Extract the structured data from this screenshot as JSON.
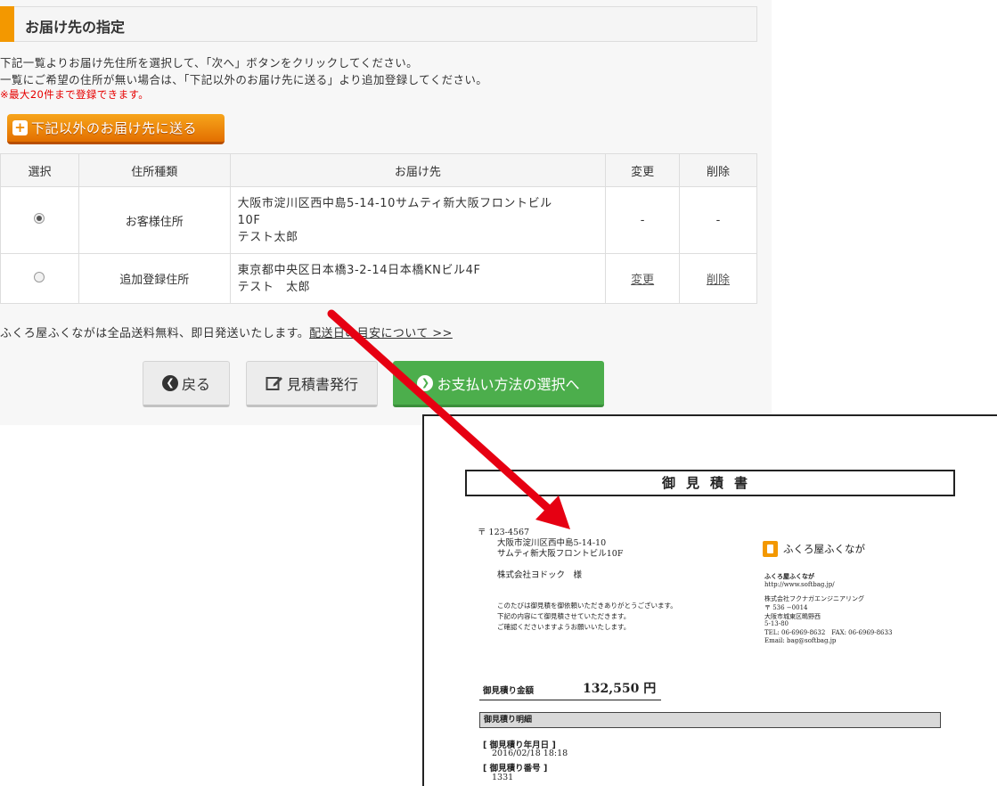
{
  "page": {
    "section_title": "お届け先の指定",
    "instruction_1": "下記一覧よりお届け先住所を選択して、「次へ」ボタンをクリックしてください。",
    "instruction_2": "一覧にご希望の住所が無い場合は、「下記以外のお届け先に送る」より追加登録してください。",
    "note": "※最大20件まで登録できます。",
    "add_button": "下記以外のお届け先に送る",
    "table": {
      "headers": [
        "選択",
        "住所種類",
        "お届け先",
        "変更",
        "削除"
      ],
      "rows": [
        {
          "selected": true,
          "type": "お客様住所",
          "address_1": "大阪市淀川区西中島5-14-10サムティ新大阪フロントビル",
          "address_2": "10F",
          "name": "テスト太郎",
          "edit": "-",
          "delete": "-"
        },
        {
          "selected": false,
          "type": "追加登録住所",
          "address_1": "東京都中央区日本橋3-2-14日本橋KNビル4F",
          "address_2": "",
          "name": "テスト　太郎",
          "edit": "変更",
          "delete": "削除"
        }
      ]
    },
    "shipping_text": "ふくろ屋ふくながは全品送料無料、即日発送いたします。",
    "shipping_link": "配送日の目安について >>",
    "buttons": {
      "back": "戻る",
      "estimate": "見積書発行",
      "payment": "お支払い方法の選択へ"
    }
  },
  "document": {
    "title": "御見積書",
    "postal": "〒 123-4567",
    "address_1": "大阪市淀川区西中島5-14-10",
    "address_2": "サムティ新大阪フロントビル10F",
    "customer": "株式会社ヨドック　様",
    "greeting_1": "このたびは御見積を御依頼いただきありがとうございます。",
    "greeting_2": "下記の内容にて御見積させていただきます。",
    "greeting_3": "ご確認くださいますようお願いいたします。",
    "shop_logo": "ふくろ屋ふくなが",
    "shop_name": "ふくろ屋ふくなが",
    "shop_url": "http://www.softbag.jp/",
    "company": "株式会社フクナガエンジニアリング",
    "company_postal": "〒 536 −0014",
    "company_address_1": "大阪市城東区鴫野西",
    "company_address_2": "5-13-80",
    "company_tel": "TEL: 06-6969-8632　FAX: 06-6969-8633",
    "company_email": "Email: bag@softbag.jp",
    "amount_label": "御見積り金額",
    "amount_value": "132,550 円",
    "details_label": "御見積り明細",
    "date_label": "[ 御見積り年月日 ]",
    "date_value": "2016/02/18 18:18",
    "number_label": "[ 御見積り番号 ]",
    "number_value": "1331"
  },
  "colors": {
    "accent_orange": "#f39800",
    "pay_green": "#4cae4c",
    "note_red": "#e60000",
    "arrow_red": "#e60012"
  }
}
